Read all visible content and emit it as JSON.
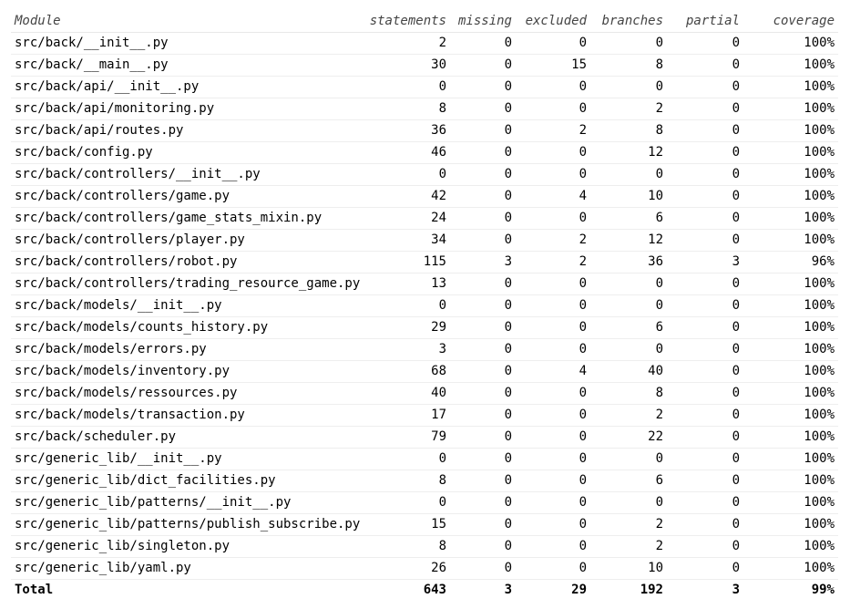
{
  "headers": {
    "module": "Module",
    "statements": "statements",
    "missing": "missing",
    "excluded": "excluded",
    "branches": "branches",
    "partial": "partial",
    "coverage": "coverage"
  },
  "rows": [
    {
      "module": "src/back/__init__.py",
      "statements": "2",
      "missing": "0",
      "excluded": "0",
      "branches": "0",
      "partial": "0",
      "coverage": "100%"
    },
    {
      "module": "src/back/__main__.py",
      "statements": "30",
      "missing": "0",
      "excluded": "15",
      "branches": "8",
      "partial": "0",
      "coverage": "100%"
    },
    {
      "module": "src/back/api/__init__.py",
      "statements": "0",
      "missing": "0",
      "excluded": "0",
      "branches": "0",
      "partial": "0",
      "coverage": "100%"
    },
    {
      "module": "src/back/api/monitoring.py",
      "statements": "8",
      "missing": "0",
      "excluded": "0",
      "branches": "2",
      "partial": "0",
      "coverage": "100%"
    },
    {
      "module": "src/back/api/routes.py",
      "statements": "36",
      "missing": "0",
      "excluded": "2",
      "branches": "8",
      "partial": "0",
      "coverage": "100%"
    },
    {
      "module": "src/back/config.py",
      "statements": "46",
      "missing": "0",
      "excluded": "0",
      "branches": "12",
      "partial": "0",
      "coverage": "100%"
    },
    {
      "module": "src/back/controllers/__init__.py",
      "statements": "0",
      "missing": "0",
      "excluded": "0",
      "branches": "0",
      "partial": "0",
      "coverage": "100%"
    },
    {
      "module": "src/back/controllers/game.py",
      "statements": "42",
      "missing": "0",
      "excluded": "4",
      "branches": "10",
      "partial": "0",
      "coverage": "100%"
    },
    {
      "module": "src/back/controllers/game_stats_mixin.py",
      "statements": "24",
      "missing": "0",
      "excluded": "0",
      "branches": "6",
      "partial": "0",
      "coverage": "100%"
    },
    {
      "module": "src/back/controllers/player.py",
      "statements": "34",
      "missing": "0",
      "excluded": "2",
      "branches": "12",
      "partial": "0",
      "coverage": "100%"
    },
    {
      "module": "src/back/controllers/robot.py",
      "statements": "115",
      "missing": "3",
      "excluded": "2",
      "branches": "36",
      "partial": "3",
      "coverage": "96%"
    },
    {
      "module": "src/back/controllers/trading_resource_game.py",
      "statements": "13",
      "missing": "0",
      "excluded": "0",
      "branches": "0",
      "partial": "0",
      "coverage": "100%"
    },
    {
      "module": "src/back/models/__init__.py",
      "statements": "0",
      "missing": "0",
      "excluded": "0",
      "branches": "0",
      "partial": "0",
      "coverage": "100%"
    },
    {
      "module": "src/back/models/counts_history.py",
      "statements": "29",
      "missing": "0",
      "excluded": "0",
      "branches": "6",
      "partial": "0",
      "coverage": "100%"
    },
    {
      "module": "src/back/models/errors.py",
      "statements": "3",
      "missing": "0",
      "excluded": "0",
      "branches": "0",
      "partial": "0",
      "coverage": "100%"
    },
    {
      "module": "src/back/models/inventory.py",
      "statements": "68",
      "missing": "0",
      "excluded": "4",
      "branches": "40",
      "partial": "0",
      "coverage": "100%"
    },
    {
      "module": "src/back/models/ressources.py",
      "statements": "40",
      "missing": "0",
      "excluded": "0",
      "branches": "8",
      "partial": "0",
      "coverage": "100%"
    },
    {
      "module": "src/back/models/transaction.py",
      "statements": "17",
      "missing": "0",
      "excluded": "0",
      "branches": "2",
      "partial": "0",
      "coverage": "100%"
    },
    {
      "module": "src/back/scheduler.py",
      "statements": "79",
      "missing": "0",
      "excluded": "0",
      "branches": "22",
      "partial": "0",
      "coverage": "100%"
    },
    {
      "module": "src/generic_lib/__init__.py",
      "statements": "0",
      "missing": "0",
      "excluded": "0",
      "branches": "0",
      "partial": "0",
      "coverage": "100%"
    },
    {
      "module": "src/generic_lib/dict_facilities.py",
      "statements": "8",
      "missing": "0",
      "excluded": "0",
      "branches": "6",
      "partial": "0",
      "coverage": "100%"
    },
    {
      "module": "src/generic_lib/patterns/__init__.py",
      "statements": "0",
      "missing": "0",
      "excluded": "0",
      "branches": "0",
      "partial": "0",
      "coverage": "100%"
    },
    {
      "module": "src/generic_lib/patterns/publish_subscribe.py",
      "statements": "15",
      "missing": "0",
      "excluded": "0",
      "branches": "2",
      "partial": "0",
      "coverage": "100%"
    },
    {
      "module": "src/generic_lib/singleton.py",
      "statements": "8",
      "missing": "0",
      "excluded": "0",
      "branches": "2",
      "partial": "0",
      "coverage": "100%"
    },
    {
      "module": "src/generic_lib/yaml.py",
      "statements": "26",
      "missing": "0",
      "excluded": "0",
      "branches": "10",
      "partial": "0",
      "coverage": "100%"
    }
  ],
  "total": {
    "module": "Total",
    "statements": "643",
    "missing": "3",
    "excluded": "29",
    "branches": "192",
    "partial": "3",
    "coverage": "99%"
  }
}
